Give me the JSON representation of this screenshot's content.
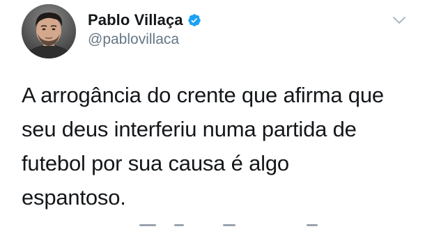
{
  "author": {
    "display_name": "Pablo Villaça",
    "handle": "@pablovillaca",
    "verified": true
  },
  "tweet": {
    "text": "A arrogância do crente que afirma que\nseu deus interferiu numa partida de\nfutebol por sua causa é algo\nespantoso."
  },
  "colors": {
    "text": "#14171a",
    "secondary": "#657786",
    "verified_blue": "#1da1f2",
    "chevron": "#aab8c2"
  },
  "icons": {
    "verified": "verified-badge-icon",
    "menu": "chevron-down-icon",
    "avatar": "avatar"
  }
}
